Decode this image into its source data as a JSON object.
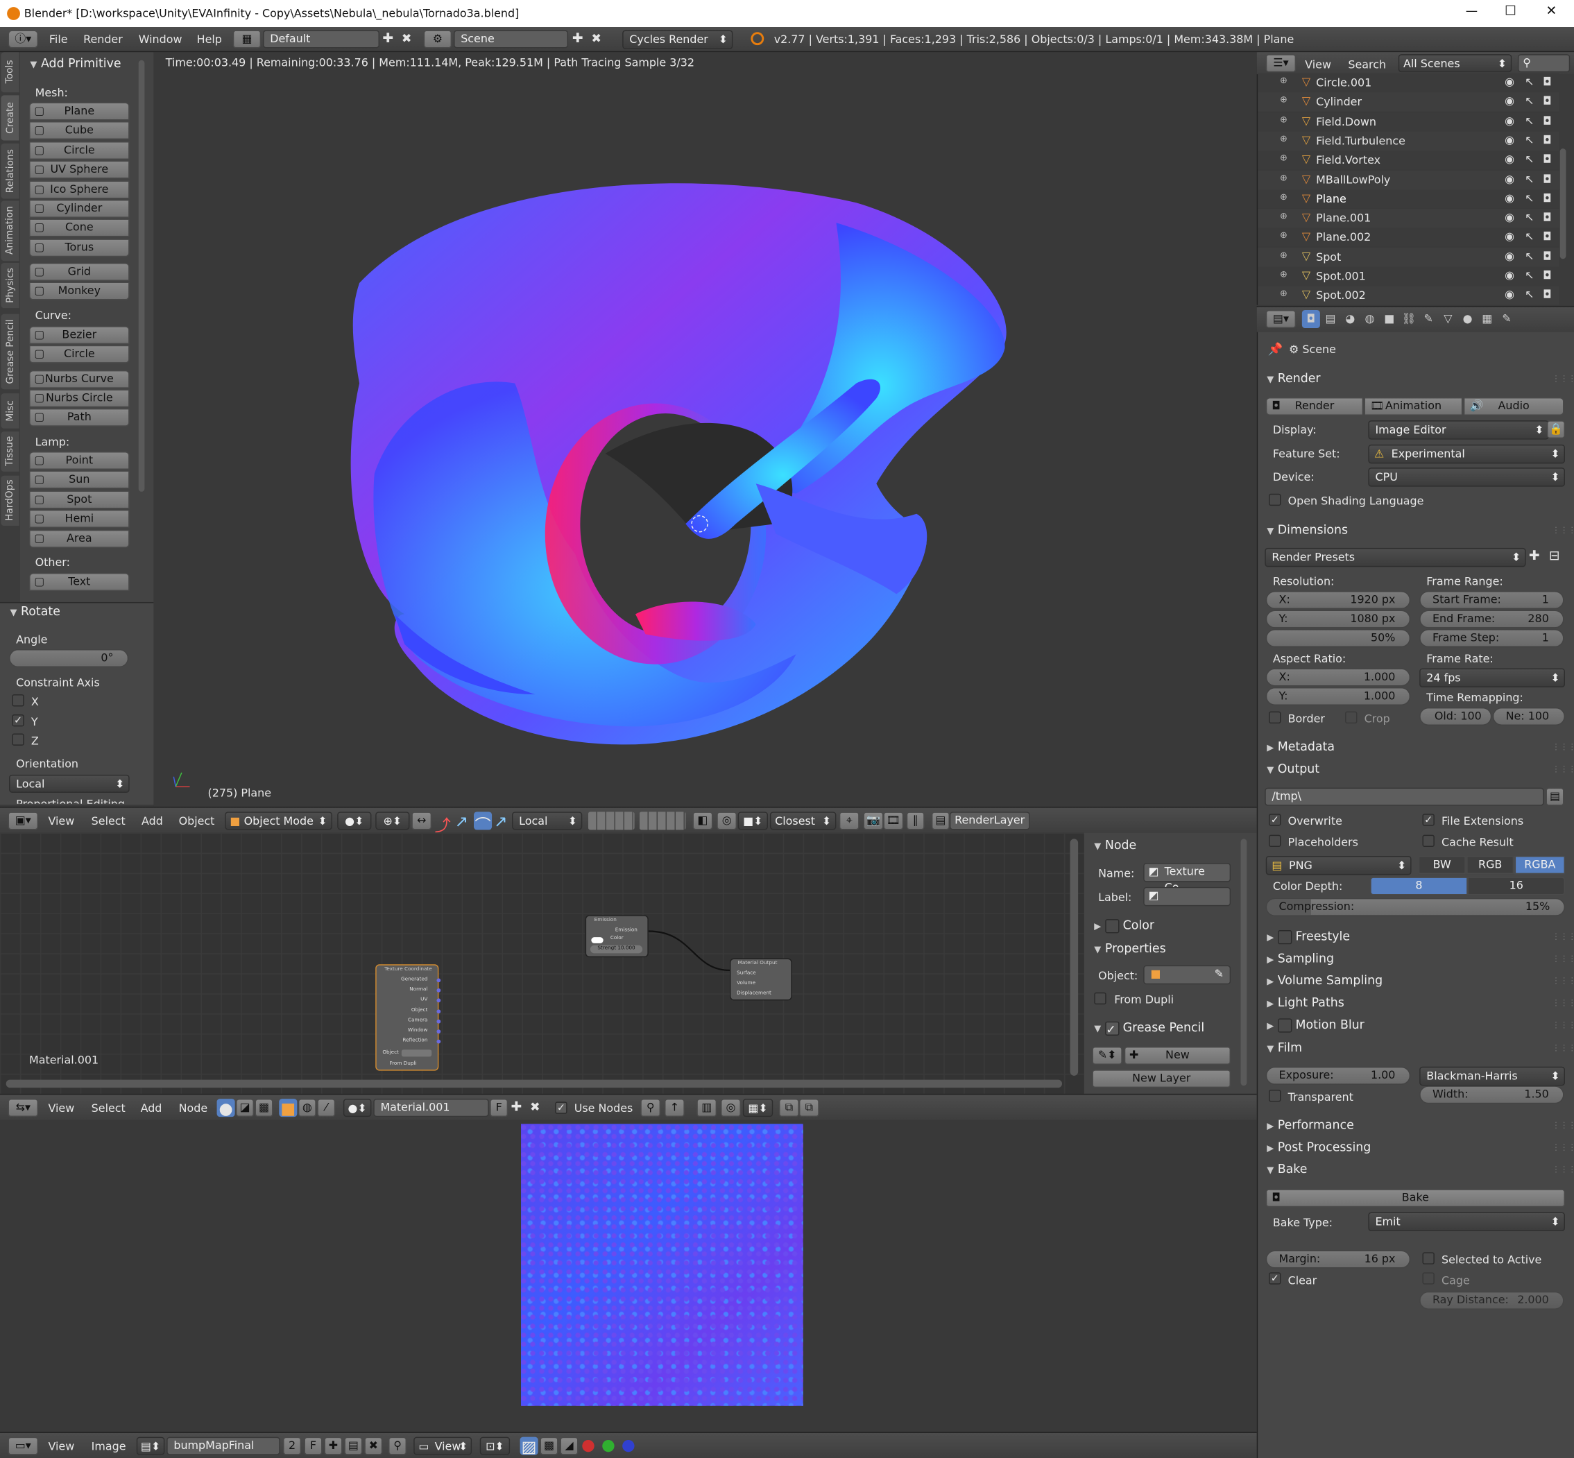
{
  "window": {
    "title": "Blender* [D:\\workspace\\Unity\\EVAInfinity - Copy\\Assets\\Nebula\\_nebula\\Tornado3a.blend]",
    "min": "—",
    "max": "☐",
    "close": "✕"
  },
  "topbar": {
    "menus": [
      "File",
      "Render",
      "Window",
      "Help"
    ],
    "layout": "Default",
    "scene": "Scene",
    "engine": "Cycles Render",
    "stats": "v2.77 | Verts:1,391 | Faces:1,293 | Tris:2,586 | Objects:0/3 | Lamps:0/1 | Mem:343.38M | Plane"
  },
  "tool_tabs": [
    "Tools",
    "Create",
    "Relations",
    "Animation",
    "Physics",
    "Grease Pencil",
    "Misc",
    "Tissue",
    "HardOps"
  ],
  "tools": {
    "title": "Add Primitive",
    "mesh_label": "Mesh:",
    "mesh": [
      "Plane",
      "Cube",
      "Circle",
      "UV Sphere",
      "Ico Sphere",
      "Cylinder",
      "Cone",
      "Torus"
    ],
    "mesh2": [
      "Grid",
      "Monkey"
    ],
    "curve_label": "Curve:",
    "curve": [
      "Bezier",
      "Circle"
    ],
    "curve2": [
      "Nurbs Curve",
      "Nurbs Circle",
      "Path"
    ],
    "lamp_label": "Lamp:",
    "lamp": [
      "Point",
      "Sun",
      "Spot",
      "Hemi",
      "Area"
    ],
    "other_label": "Other:",
    "other": [
      "Text"
    ]
  },
  "rotate": {
    "title": "Rotate",
    "angle_label": "Angle",
    "angle": "0°",
    "axis_label": "Constraint Axis",
    "axes": [
      {
        "n": "X",
        "on": false
      },
      {
        "n": "Y",
        "on": true
      },
      {
        "n": "Z",
        "on": false
      }
    ],
    "orient_label": "Orientation",
    "orient": "Local",
    "cut": "Proportional Editing"
  },
  "viewport": {
    "status": "Time:00:03.49 | Remaining:00:33.76 | Mem:111.14M, Peak:129.51M | Path Tracing Sample 3/32",
    "label": "(275) Plane",
    "menus": [
      "View",
      "Select",
      "Add",
      "Object"
    ],
    "mode": "Object Mode",
    "orientation": "Local",
    "snap": "Closest",
    "layer": "RenderLayer"
  },
  "outliner": {
    "menus": [
      "View",
      "Search"
    ],
    "filter": "All Scenes",
    "items": [
      {
        "name": "Circle.001",
        "c": "#e08a3a"
      },
      {
        "name": "Cylinder",
        "c": "#e08a3a"
      },
      {
        "name": "Field.Down",
        "c": "#e0a040"
      },
      {
        "name": "Field.Turbulence",
        "c": "#e0a040"
      },
      {
        "name": "Field.Vortex",
        "c": "#e0a040"
      },
      {
        "name": "MBallLowPoly",
        "c": "#e08a3a"
      },
      {
        "name": "Plane",
        "c": "#e08a3a"
      },
      {
        "name": "Plane.001",
        "c": "#e08a3a"
      },
      {
        "name": "Plane.002",
        "c": "#e08a3a"
      },
      {
        "name": "Spot",
        "c": "#e0c060"
      },
      {
        "name": "Spot.001",
        "c": "#e0c060"
      },
      {
        "name": "Spot.002",
        "c": "#e0c060"
      }
    ]
  },
  "props": {
    "scene": "Scene",
    "render_title": "Render",
    "tabs": [
      "Render",
      "Animation",
      "Audio"
    ],
    "display_label": "Display:",
    "display": "Image Editor",
    "feature_label": "Feature Set:",
    "feature": "Experimental",
    "device_label": "Device:",
    "device": "CPU",
    "osl": "Open Shading Language",
    "dimensions": "Dimensions",
    "presets": "Render Presets",
    "resolution": "Resolution:",
    "res_x": "1920 px",
    "res_y": "1080 px",
    "res_pct": "50%",
    "x_label": "X:",
    "y_label": "Y:",
    "frame_range": "Frame Range:",
    "start_label": "Start Frame:",
    "start": "1",
    "end_label": "End Frame:",
    "end": "280",
    "step_label": "Frame Step:",
    "step": "1",
    "aspect": "Aspect Ratio:",
    "asp_x": "1.000",
    "asp_y": "1.000",
    "frame_rate": "Frame Rate:",
    "fps": "24 fps",
    "time_remap": "Time Remapping:",
    "old": "Old: 100",
    "new": "Ne:  100",
    "border": "Border",
    "crop": "Crop",
    "metadata": "Metadata",
    "output": "Output",
    "path": "/tmp\\",
    "overwrite": "Overwrite",
    "file_ext": "File Extensions",
    "placeholders": "Placeholders",
    "cache": "Cache Result",
    "format": "PNG",
    "bw": "BW",
    "rgb": "RGB",
    "rgba": "RGBA",
    "depth_label": "Color Depth:",
    "d8": "8",
    "d16": "16",
    "compression": "Compression:",
    "comp_val": "15%",
    "comp_pct": 0.15,
    "freestyle": "Freestyle",
    "sampling": "Sampling",
    "volume": "Volume Sampling",
    "light": "Light Paths",
    "motion": "Motion Blur",
    "film": "Film",
    "exposure_label": "Exposure:",
    "exposure": "1.00",
    "filter": "Blackman-Harris",
    "transparent": "Transparent",
    "width_label": "Width:",
    "width": "1.50",
    "performance": "Performance",
    "post": "Post Processing",
    "bake": "Bake",
    "bake_btn": "Bake",
    "bake_type_label": "Bake Type:",
    "bake_type": "Emit",
    "margin_label": "Margin:",
    "margin": "16 px",
    "selected": "Selected to Active",
    "clear": "Clear",
    "cage": "Cage",
    "ray": "Ray Distance:",
    "ray_val": "2.000"
  },
  "node": {
    "title": "Node",
    "name_label": "Name:",
    "name": "Texture Co...",
    "label_label": "Label:",
    "color": "Color",
    "properties": "Properties",
    "object_label": "Object:",
    "from_dupli": "From Dupli",
    "gp": "Grease Pencil",
    "new": "New",
    "new_layer": "New Layer",
    "material_label": "Material.001",
    "menus": [
      "View",
      "Select",
      "Add",
      "Node"
    ],
    "material": "Material.001",
    "use_nodes": "Use Nodes",
    "emission": {
      "title": "Emission",
      "out": "Emission",
      "color": "Color",
      "strength": "Strengt 10.000"
    },
    "output": {
      "title": "Material Output",
      "sockets": [
        "Surface",
        "Volume",
        "Displacement"
      ]
    },
    "texcoord": {
      "title": "Texture Coordinate",
      "sockets": [
        "Generated",
        "Normal",
        "UV",
        "Object",
        "Camera",
        "Window",
        "Reflection"
      ],
      "object": "Object",
      "dupli": "From Dupli"
    }
  },
  "image_editor": {
    "menus": [
      "View",
      "Image"
    ],
    "image": "bumpMapFinal",
    "users": "2",
    "f": "F",
    "view": "View"
  },
  "colors": {
    "accent": "#5680c2",
    "bg": "#393939",
    "panel": "#4a4a4a"
  }
}
